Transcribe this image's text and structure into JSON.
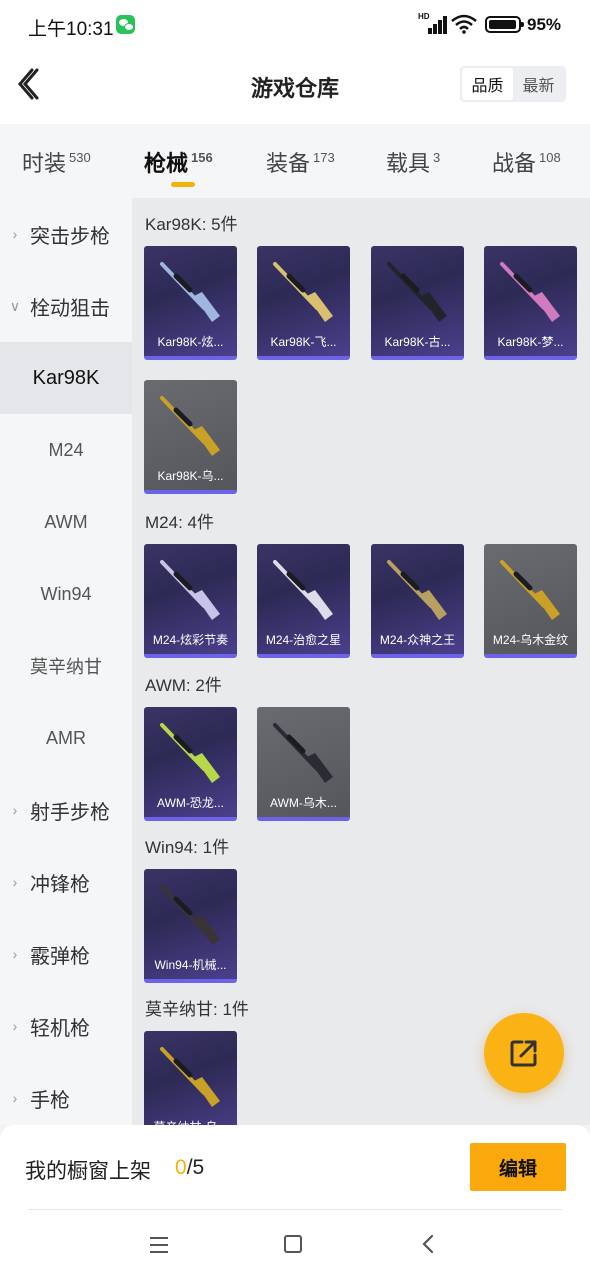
{
  "status_bar": {
    "time": "上午10:31",
    "battery": "95%",
    "network_label": "HD",
    "icons": [
      "wechat-icon",
      "signal-icon",
      "wifi-icon",
      "battery-icon"
    ]
  },
  "header": {
    "title": "游戏仓库",
    "sort_options": [
      "品质",
      "最新"
    ],
    "active_sort": "品质"
  },
  "tabs": [
    {
      "label": "时装",
      "count": "530"
    },
    {
      "label": "枪械",
      "count": "156",
      "active": true
    },
    {
      "label": "装备",
      "count": "173"
    },
    {
      "label": "载具",
      "count": "3"
    },
    {
      "label": "战备",
      "count": "108"
    }
  ],
  "sidebar": {
    "items": [
      {
        "label": "突击步枪",
        "type": "category",
        "expanded": false
      },
      {
        "label": "栓动狙击",
        "type": "category",
        "expanded": true
      },
      {
        "label": "Kar98K",
        "type": "sub",
        "selected": true
      },
      {
        "label": "M24",
        "type": "sub"
      },
      {
        "label": "AWM",
        "type": "sub"
      },
      {
        "label": "Win94",
        "type": "sub"
      },
      {
        "label": "莫辛纳甘",
        "type": "sub"
      },
      {
        "label": "AMR",
        "type": "sub"
      },
      {
        "label": "射手步枪",
        "type": "category",
        "expanded": false
      },
      {
        "label": "冲锋枪",
        "type": "category",
        "expanded": false
      },
      {
        "label": "霰弹枪",
        "type": "category",
        "expanded": false
      },
      {
        "label": "轻机枪",
        "type": "category",
        "expanded": false
      },
      {
        "label": "手枪",
        "type": "category",
        "expanded": false
      }
    ]
  },
  "sections": [
    {
      "title": "Kar98K: 5件",
      "items": [
        {
          "name": "Kar98K-炫...",
          "bg": "purple",
          "gun_color": "#9fb6e0"
        },
        {
          "name": "Kar98K-飞...",
          "bg": "purple",
          "gun_color": "#d8c070"
        },
        {
          "name": "Kar98K-古...",
          "bg": "purple",
          "gun_color": "#22242c"
        },
        {
          "name": "Kar98K-梦...",
          "bg": "purple",
          "gun_color": "#d07ac0"
        },
        {
          "name": "Kar98K-乌...",
          "bg": "gray",
          "gun_color": "#c9a126"
        }
      ]
    },
    {
      "title": "M24: 4件",
      "items": [
        {
          "name": "M24-炫彩节奏",
          "bg": "purple",
          "gun_color": "#c8c4e8"
        },
        {
          "name": "M24-治愈之星",
          "bg": "purple",
          "gun_color": "#dcdde8"
        },
        {
          "name": "M24-众神之王",
          "bg": "purple",
          "gun_color": "#b8a060"
        },
        {
          "name": "M24-乌木金纹",
          "bg": "gray",
          "gun_color": "#c9a126"
        }
      ]
    },
    {
      "title": "AWM: 2件",
      "items": [
        {
          "name": "AWM-恐龙...",
          "bg": "purple",
          "gun_color": "#b6d84a"
        },
        {
          "name": "AWM-乌木...",
          "bg": "gray",
          "gun_color": "#2a2c33"
        }
      ]
    },
    {
      "title": "Win94: 1件",
      "items": [
        {
          "name": "Win94-机械...",
          "bg": "purple",
          "gun_color": "#3a3438"
        }
      ]
    },
    {
      "title": "莫辛纳甘: 1件",
      "items": [
        {
          "name": "莫辛纳甘-乌...",
          "bg": "purple",
          "gun_color": "#c9a126"
        }
      ]
    }
  ],
  "fab": {
    "icon": "share-icon"
  },
  "bottom": {
    "showcase_label": "我的橱窗上架",
    "showcase_current": "0",
    "showcase_total": "/5",
    "edit_label": "编辑"
  },
  "colors": {
    "accent": "#f5b30a",
    "button": "#fba80c",
    "card_purple": "#2d2a55",
    "card_gray": "#55565b",
    "card_stripe": "#6c63e8"
  }
}
